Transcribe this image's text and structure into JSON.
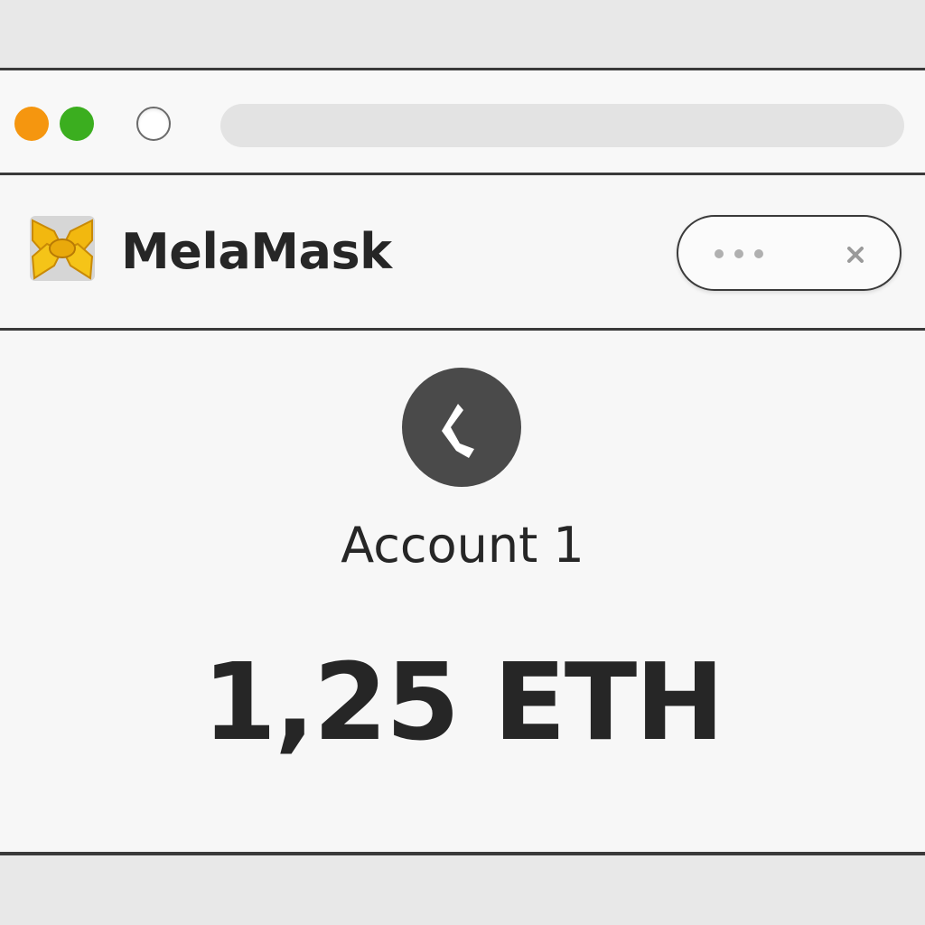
{
  "browser": {
    "traffic_lights": [
      "orange-dot",
      "green-dot"
    ],
    "address_bar": {
      "value": "",
      "placeholder": ""
    }
  },
  "colors": {
    "orange_dot": "#f5960f",
    "green_dot": "#3bae1f",
    "brand_yellow": "#f2b80f"
  },
  "header": {
    "logo_icon": "fox-logo-icon",
    "title": "MelaMask",
    "menu": {
      "dots_icon": "more-dots-icon",
      "close_icon": "close-icon"
    }
  },
  "account": {
    "avatar_icon": "account-avatar-icon",
    "name": "Account 1",
    "balance": "1,25 ETH"
  }
}
